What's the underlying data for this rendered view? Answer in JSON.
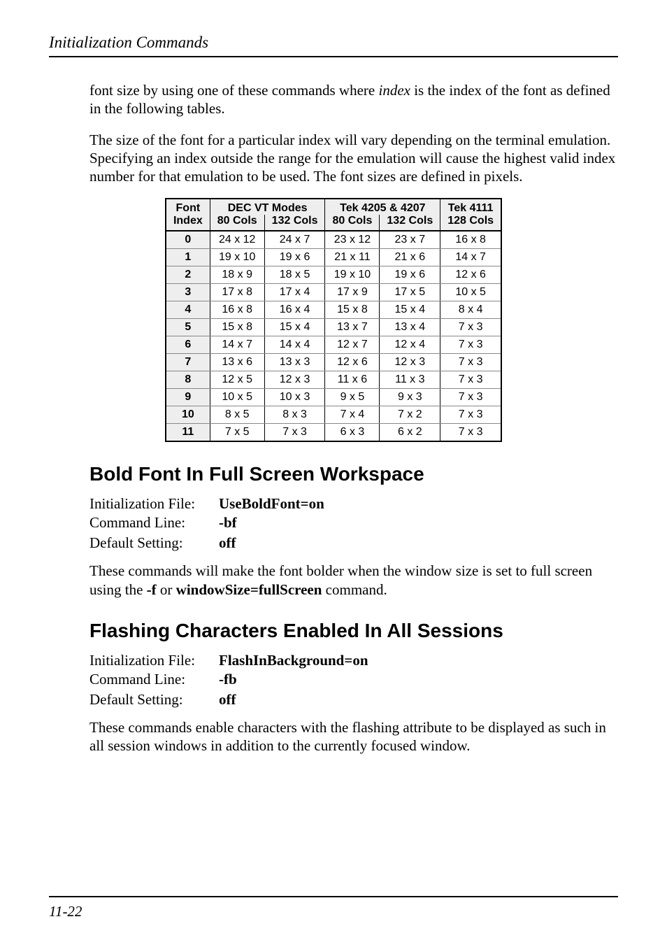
{
  "header": {
    "running_head": "Initialization Commands"
  },
  "intro": {
    "p1_a": "font size by using one of these commands where ",
    "p1_index": "index",
    "p1_b": " is the index of the font as defined in the following tables.",
    "p2": "The size of the font for a particular index will vary depending on the terminal emulation. Specifying an index outside the range for the emulation will cause the highest valid index number for that emulation to be used. The font sizes are defined in pixels."
  },
  "table": {
    "head": {
      "font": "Font",
      "index": "Index",
      "dec": "DEC VT Modes",
      "tek4205": "Tek 4205 & 4207",
      "tek4111": "Tek 4111",
      "c80": "80 Cols",
      "c132": "132 Cols",
      "c128": "128 Cols"
    },
    "rows": [
      {
        "idx": "0",
        "a": "24 x 12",
        "b": "24 x 7",
        "c": "23 x 12",
        "d": "23 x 7",
        "e": "16 x 8"
      },
      {
        "idx": "1",
        "a": "19 x 10",
        "b": "19 x 6",
        "c": "21 x 11",
        "d": "21 x 6",
        "e": "14 x 7"
      },
      {
        "idx": "2",
        "a": "18 x 9",
        "b": "18 x 5",
        "c": "19 x 10",
        "d": "19 x 6",
        "e": "12 x 6"
      },
      {
        "idx": "3",
        "a": "17 x 8",
        "b": "17 x 4",
        "c": "17 x 9",
        "d": "17 x 5",
        "e": "10 x 5"
      },
      {
        "idx": "4",
        "a": "16 x 8",
        "b": "16 x 4",
        "c": "15 x 8",
        "d": "15 x 4",
        "e": "8 x 4"
      },
      {
        "idx": "5",
        "a": "15 x 8",
        "b": "15 x 4",
        "c": "13 x 7",
        "d": "13 x 4",
        "e": "7 x 3"
      },
      {
        "idx": "6",
        "a": "14 x 7",
        "b": "14 x 4",
        "c": "12 x 7",
        "d": "12 x 4",
        "e": "7 x 3"
      },
      {
        "idx": "7",
        "a": "13 x 6",
        "b": "13 x 3",
        "c": "12 x 6",
        "d": "12 x 3",
        "e": "7 x 3"
      },
      {
        "idx": "8",
        "a": "12 x 5",
        "b": "12 x 3",
        "c": "11 x 6",
        "d": "11 x 3",
        "e": "7 x 3"
      },
      {
        "idx": "9",
        "a": "10 x 5",
        "b": "10 x 3",
        "c": "9 x 5",
        "d": "9 x 3",
        "e": "7 x 3"
      },
      {
        "idx": "10",
        "a": "8 x 5",
        "b": "8 x 3",
        "c": "7 x 4",
        "d": "7 x 2",
        "e": "7 x 3"
      },
      {
        "idx": "11",
        "a": "7 x 5",
        "b": "7 x 3",
        "c": "6 x 3",
        "d": "6 x 2",
        "e": "7 x 3"
      }
    ]
  },
  "bold_font": {
    "heading": "Bold Font In Full Screen Workspace",
    "init_label": "Initialization File:",
    "init_value": "UseBoldFont=on",
    "cmd_label": "Command Line:",
    "cmd_value": "-bf",
    "def_label": "Default Setting:",
    "def_value": "off",
    "desc_a": "These commands will make the font bolder when the window size is set to full screen using the ",
    "desc_f": "-f",
    "desc_or": " or ",
    "desc_ws": "windowSize=fullScreen",
    "desc_b": " command."
  },
  "flashing": {
    "heading": "Flashing Characters Enabled In All Sessions",
    "init_label": "Initialization File:",
    "init_value": "FlashInBackground=on",
    "cmd_label": "Command Line:",
    "cmd_value": "-fb",
    "def_label": "Default Setting:",
    "def_value": "off",
    "desc": "These commands enable characters with the flashing attribute to be displayed as such in all session windows in addition to the currently focused window."
  },
  "footer": {
    "page": "11-22"
  }
}
